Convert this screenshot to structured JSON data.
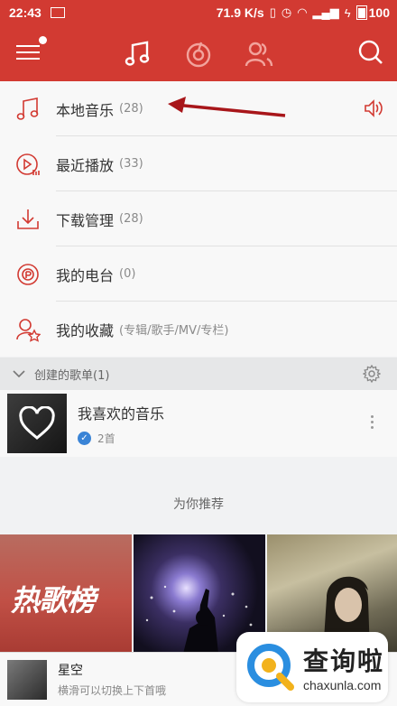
{
  "status_bar": {
    "time": "22:43",
    "speed": "71.9 K/s",
    "battery": "100"
  },
  "top_bar": {
    "tabs": [
      "music-tab",
      "discover-tab",
      "friends-tab"
    ],
    "accent_color": "#d23a32"
  },
  "menu": {
    "items": [
      {
        "label": "本地音乐",
        "count": "(28)"
      },
      {
        "label": "最近播放",
        "count": "(33)"
      },
      {
        "label": "下载管理",
        "count": "(28)"
      },
      {
        "label": "我的电台",
        "count": "(0)"
      },
      {
        "label": "我的收藏",
        "count": "(专辑/歌手/MV/专栏)"
      }
    ]
  },
  "created_playlists": {
    "header": "创建的歌单(1)",
    "items": [
      {
        "title": "我喜欢的音乐",
        "subtitle": "2首"
      }
    ]
  },
  "recommend": {
    "title": "为你推荐",
    "tile1_text": "热歌榜"
  },
  "player": {
    "song": "星空",
    "hint": "横滑可以切换上下首哦"
  },
  "watermark": {
    "brand": "查询啦",
    "url": "chaxunla.com"
  }
}
